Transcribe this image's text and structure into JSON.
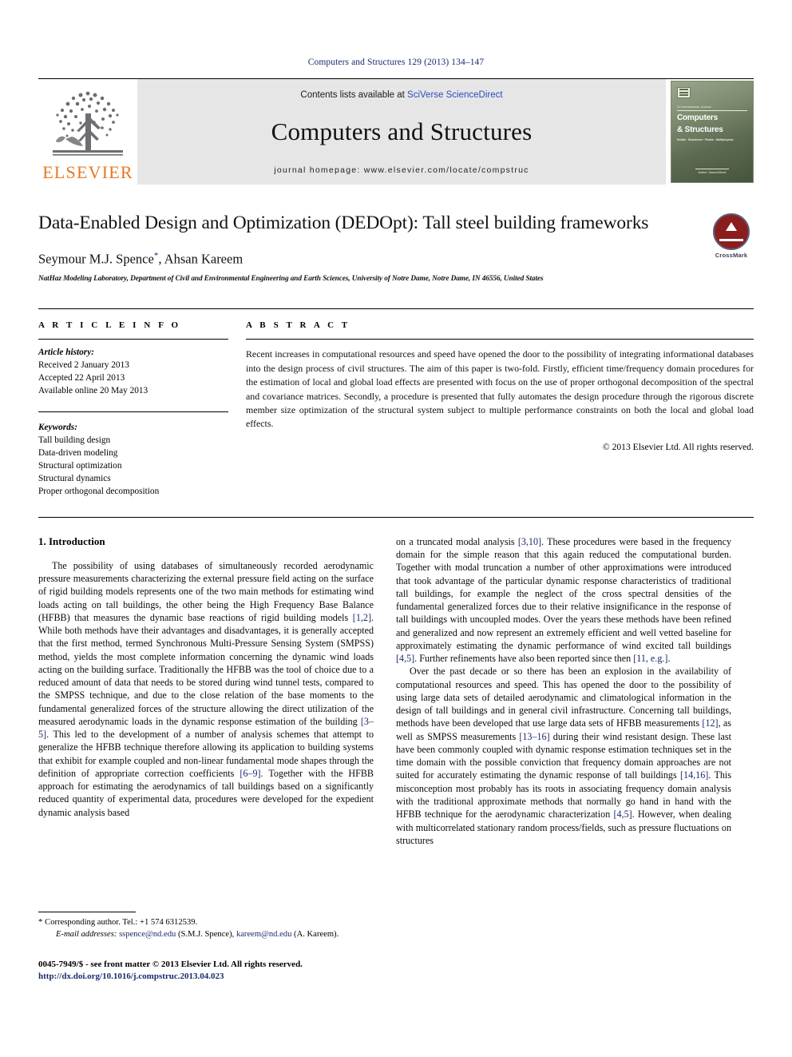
{
  "running_head": "Computers and Structures 129 (2013) 134–147",
  "masthead": {
    "publisher_logo_label": "ELSEVIER",
    "contents_prefix": "Contents lists available at ",
    "contents_link": "SciVerse ScienceDirect",
    "journal_title": "Computers and Structures",
    "homepage": "journal homepage: www.elsevier.com/locate/compstruc",
    "cover": {
      "kicker": "An International Journal",
      "title_line1": "Computers",
      "title_line2": "& Structures",
      "subtitle": "Solids  ·  Structures  ·  Fluids  ·  Multiphysics",
      "footer": "Author: ScienceDirect"
    }
  },
  "article": {
    "title": "Data-Enabled Design and Optimization (DEDOpt): Tall steel building frameworks",
    "crossmark_label": "CrossMark",
    "authors": "Seymour M.J. Spence",
    "authors_star": "*",
    "authors_rest": ", Ahsan Kareem",
    "affiliation": "NatHaz Modeling Laboratory, Department of Civil and Environmental Engineering and Earth Sciences, University of Notre Dame, Notre Dame, IN 46556, United States"
  },
  "article_info": {
    "heading": "A R T I C L E   I N F O",
    "history_label": "Article history:",
    "history": [
      "Received 2 January 2013",
      "Accepted 22 April 2013",
      "Available online 20 May 2013"
    ],
    "keywords_label": "Keywords:",
    "keywords": [
      "Tall building design",
      "Data-driven modeling",
      "Structural optimization",
      "Structural dynamics",
      "Proper orthogonal decomposition"
    ]
  },
  "abstract": {
    "heading": "A B S T R A C T",
    "text": "Recent increases in computational resources and speed have opened the door to the possibility of integrating informational databases into the design process of civil structures. The aim of this paper is two-fold. Firstly, efficient time/frequency domain procedures for the estimation of local and global load effects are presented with focus on the use of proper orthogonal decomposition of the spectral and covariance matrices. Secondly, a procedure is presented that fully automates the design procedure through the rigorous discrete member size optimization of the structural system subject to multiple performance constraints on both the local and global load effects.",
    "copyright": "© 2013 Elsevier Ltd. All rights reserved."
  },
  "body": {
    "section_heading": "1. Introduction",
    "left_paragraph_1_a": "The possibility of using databases of simultaneously recorded aerodynamic pressure measurements characterizing the external pressure field acting on the surface of rigid building models represents one of the two main methods for estimating wind loads acting on tall buildings, the other being the High Frequency Base Balance (HFBB) that measures the dynamic base reactions of rigid building models ",
    "cite_1_2": "[1,2]",
    "left_paragraph_1_b": ". While both methods have their advantages and disadvantages, it is generally accepted that the first method, termed Synchronous Multi-Pressure Sensing System (SMPSS) method, yields the most complete information concerning the dynamic wind loads acting on the building surface. Traditionally the HFBB was the tool of choice due to a reduced amount of data that needs to be stored during wind tunnel tests, compared to the SMPSS technique, and due to the close relation of the base moments to the fundamental generalized forces of the structure allowing the direct utilization of the measured aerodynamic loads in the dynamic response estimation of the building ",
    "cite_3_5": "[3–5]",
    "left_paragraph_1_c": ". This led to the development of a number of analysis schemes that attempt to generalize the HFBB technique therefore allowing its application to building systems that exhibit for example coupled and non-linear fundamental mode shapes through the definition of appropriate correction coefficients ",
    "cite_6_9": "[6–9]",
    "left_paragraph_1_d": ". Together with the HFBB approach for estimating the aerodynamics of tall buildings based on a significantly reduced quantity of experimental data, procedures were developed for the expedient dynamic analysis based",
    "right_paragraph_1_a": "on a truncated modal analysis ",
    "cite_3_10": "[3,10]",
    "right_paragraph_1_b": ". These procedures were based in the frequency domain for the simple reason that this again reduced the computational burden. Together with modal truncation a number of other approximations were introduced that took advantage of the particular dynamic response characteristics of traditional tall buildings, for example the neglect of the cross spectral densities of the fundamental generalized forces due to their relative insignificance in the response of tall buildings with uncoupled modes. Over the years these methods have been refined and generalized and now represent an extremely efficient and well vetted baseline for approximately estimating the dynamic performance of wind excited tall buildings ",
    "cite_4_5": "[4,5]",
    "right_paragraph_1_c": ". Further refinements have also been reported since then ",
    "cite_11": "[11, e.g.]",
    "right_paragraph_1_d": ".",
    "right_paragraph_2_a": "Over the past decade or so there has been an explosion in the availability of computational resources and speed. This has opened the door to the possibility of using large data sets of detailed aerodynamic and climatological information in the design of tall buildings and in general civil infrastructure. Concerning tall buildings, methods have been developed that use large data sets of HFBB measurements ",
    "cite_12": "[12]",
    "right_paragraph_2_b": ", as well as SMPSS measurements ",
    "cite_13_16": "[13–16]",
    "right_paragraph_2_c": " during their wind resistant design. These last have been commonly coupled with dynamic response estimation techniques set in the time domain with the possible conviction that frequency domain approaches are not suited for accurately estimating the dynamic response of tall buildings ",
    "cite_14_16": "[14,16]",
    "right_paragraph_2_d": ". This misconception most probably has its roots in associating frequency domain analysis with the traditional approximate methods that normally go hand in hand with the HFBB technique for the aerodynamic characterization ",
    "cite_4_5b": "[4,5]",
    "right_paragraph_2_e": ". However, when dealing with multicorrelated stationary random process/fields, such as pressure fluctuations on structures"
  },
  "footnotes": {
    "corresponding": "Corresponding author. Tel.: +1 574 6312539.",
    "star": "*",
    "emails_label": "E-mail addresses:",
    "email_1": "sspence@nd.edu",
    "email_1_owner": " (S.M.J. Spence), ",
    "email_2": "kareem@nd.edu",
    "email_2_owner": " (A. Kareem)."
  },
  "imprint": {
    "issn_line": "0045-7949/$ - see front matter © 2013 Elsevier Ltd. All rights reserved.",
    "doi": "http://dx.doi.org/10.1016/j.compstruc.2013.04.023"
  },
  "colors": {
    "link_blue": "#2f4bbd",
    "cite_navy": "#1b2a6b",
    "elsevier_orange": "#E87722",
    "banner_gray": "#e6e6e6",
    "crossmark_red": "#8c1d1d"
  }
}
